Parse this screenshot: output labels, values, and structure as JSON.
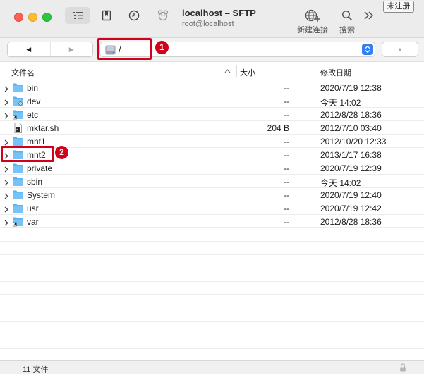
{
  "window": {
    "title": "localhost – SFTP",
    "subtitle": "root@localhost",
    "unregistered_label": "未注册",
    "toolbar": {
      "new_connection_label": "新建连接",
      "search_label": "搜索"
    }
  },
  "pathbar": {
    "back_glyph": "◀",
    "forward_glyph": "▶",
    "path": "/",
    "up_glyph": "▲"
  },
  "columns": {
    "name": "文件名",
    "size": "大小",
    "date": "修改日期"
  },
  "files": [
    {
      "name": "bin",
      "size": "--",
      "date": "2020/7/19 12:38",
      "icon": "folder-icon"
    },
    {
      "name": "dev",
      "size": "--",
      "date": "今天 14:02",
      "icon": "folder-gear-icon"
    },
    {
      "name": "etc",
      "size": "--",
      "date": "2012/8/28 18:36",
      "icon": "folder-alias-icon"
    },
    {
      "name": "mktar.sh",
      "size": "204 B",
      "date": "2012/7/10 03:40",
      "icon": "script-file-icon"
    },
    {
      "name": "mnt1",
      "size": "--",
      "date": "2012/10/20 12:33",
      "icon": "folder-icon"
    },
    {
      "name": "mnt2",
      "size": "--",
      "date": "2013/1/17 16:38",
      "icon": "folder-icon"
    },
    {
      "name": "private",
      "size": "--",
      "date": "2020/7/19 12:39",
      "icon": "folder-icon"
    },
    {
      "name": "sbin",
      "size": "--",
      "date": "今天 14:02",
      "icon": "folder-icon"
    },
    {
      "name": "System",
      "size": "--",
      "date": "2020/7/19 12:40",
      "icon": "folder-icon"
    },
    {
      "name": "usr",
      "size": "--",
      "date": "2020/7/19 12:42",
      "icon": "folder-icon"
    },
    {
      "name": "var",
      "size": "--",
      "date": "2012/8/28 18:36",
      "icon": "folder-alias-icon"
    }
  ],
  "status": {
    "count": "11 文件"
  },
  "annotations": {
    "badge1": "1",
    "badge2": "2",
    "color": "#d0021b"
  },
  "colors": {
    "folder": "#5ab2f2",
    "accent": "#2f7ff6"
  }
}
